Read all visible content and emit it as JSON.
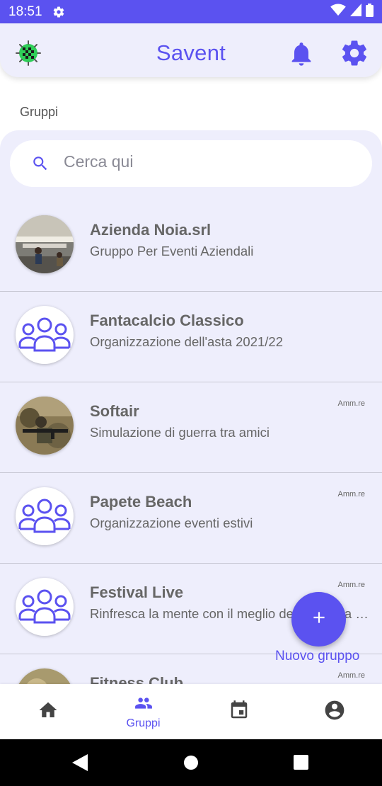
{
  "status_bar": {
    "time": "18:51",
    "icons": [
      "settings-icon",
      "wifi-icon",
      "signal-icon",
      "battery-icon"
    ]
  },
  "app_bar": {
    "title": "Savent",
    "logo": "app-logo-icon",
    "notifications_icon": "bell-icon",
    "settings_icon": "gear-icon"
  },
  "section": {
    "label": "Gruppi"
  },
  "search": {
    "placeholder": "Cerca qui",
    "value": ""
  },
  "groups": [
    {
      "title": "Azienda Noia.srl",
      "subtitle": "Gruppo Per Eventi Aziendali",
      "badge": "",
      "avatar": "office-photo"
    },
    {
      "title": "Fantacalcio Classico",
      "subtitle": "Organizzazione dell'asta 2021/22",
      "badge": "",
      "avatar": "group-icon"
    },
    {
      "title": "Softair",
      "subtitle": "Simulazione di guerra tra amici",
      "badge": "Amm.re",
      "avatar": "softair-photo"
    },
    {
      "title": "Papete Beach",
      "subtitle": "Organizzazione eventi estivi",
      "badge": "Amm.re",
      "avatar": "group-icon"
    },
    {
      "title": "Festival Live",
      "subtitle": "Rinfresca la mente con il meglio della musica dal vivo",
      "badge": "Amm.re",
      "avatar": "group-icon"
    },
    {
      "title": "Fitness Club",
      "subtitle": "",
      "badge": "Amm.re",
      "avatar": "fitness-photo"
    }
  ],
  "fab": {
    "icon": "plus-icon",
    "label": "Nuovo gruppo"
  },
  "bottom_nav": [
    {
      "id": "home",
      "icon": "home-icon",
      "label": "",
      "active": false
    },
    {
      "id": "groups",
      "icon": "groups-icon",
      "label": "Gruppi",
      "active": true
    },
    {
      "id": "calendar",
      "icon": "calendar-icon",
      "label": "",
      "active": false
    },
    {
      "id": "profile",
      "icon": "account-icon",
      "label": "",
      "active": false
    }
  ],
  "colors": {
    "primary": "#5b52f0",
    "background": "#eeeefc",
    "nav_inactive": "#444444"
  }
}
